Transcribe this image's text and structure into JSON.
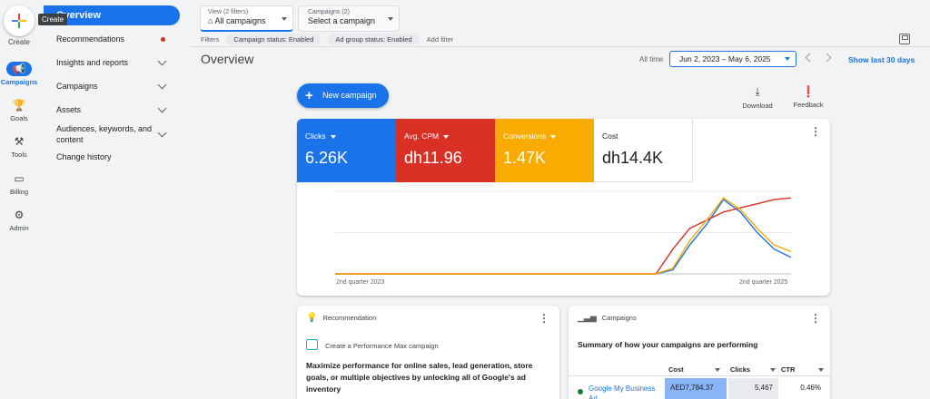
{
  "rail": {
    "create_label": "Create",
    "tooltip": "Create",
    "items": [
      {
        "label": "Campaigns",
        "icon": "megaphone-icon",
        "active": true
      },
      {
        "label": "Goals",
        "icon": "trophy-icon"
      },
      {
        "label": "Tools",
        "icon": "tools-icon"
      },
      {
        "label": "Billing",
        "icon": "credit-card-icon"
      },
      {
        "label": "Admin",
        "icon": "gear-icon"
      }
    ]
  },
  "nav": {
    "active": "Overview",
    "items": [
      "Recommendations",
      "Insights and reports",
      "Campaigns",
      "Assets",
      "Audiences, keywords, and content",
      "Change history"
    ]
  },
  "view": {
    "label": "View (2 filters)",
    "value": "All campaigns"
  },
  "campaign_select": {
    "label": "Campaigns (2)",
    "value": "Select a campaign"
  },
  "filters": {
    "label": "Filters",
    "chips": [
      "Campaign status: Enabled",
      "Ad group status: Enabled"
    ],
    "add": "Add filter"
  },
  "page_title": "Overview",
  "date": {
    "all_time": "All time",
    "range": "Jun 2, 2023 – May 6, 2025",
    "show": "Show last 30 days"
  },
  "actions": {
    "new_campaign": "New campaign",
    "download": "Download",
    "feedback": "Feedback"
  },
  "metrics": [
    {
      "label": "Clicks",
      "value": "6.26K",
      "color": "#1a73e8"
    },
    {
      "label": "Avg. CPM",
      "value": "dh11.96",
      "color": "#d93025"
    },
    {
      "label": "Conversions",
      "value": "1.47K",
      "color": "#f9ab00"
    },
    {
      "label": "Cost",
      "value": "dh14.4K",
      "color": "#ffffff"
    }
  ],
  "chart_data": {
    "type": "line",
    "x": [
      "2nd quarter 2023",
      "",
      "",
      "",
      "",
      "",
      "",
      "",
      "",
      "",
      "",
      "",
      "",
      "",
      "",
      "",
      "",
      "",
      "",
      "",
      "",
      "",
      "",
      "",
      "",
      "",
      "",
      "2nd quarter 2025"
    ],
    "x_tick_labels": [
      "2nd quarter 2023",
      "2nd quarter 2025"
    ],
    "series": [
      {
        "color": "#1a73e8",
        "values": [
          0,
          0,
          0,
          0,
          0,
          0,
          0,
          0,
          0,
          0,
          0,
          0,
          0,
          0,
          0,
          0,
          0,
          0,
          0,
          0,
          0.05,
          0.35,
          0.6,
          0.9,
          0.75,
          0.5,
          0.3,
          0.2
        ]
      },
      {
        "color": "#d93025",
        "values": [
          0,
          0,
          0,
          0,
          0,
          0,
          0,
          0,
          0,
          0,
          0,
          0,
          0,
          0,
          0,
          0,
          0,
          0,
          0,
          0,
          0.3,
          0.55,
          0.65,
          0.75,
          0.8,
          0.85,
          0.9,
          0.92
        ]
      },
      {
        "color": "#f9ab00",
        "values": [
          0,
          0,
          0,
          0,
          0,
          0,
          0,
          0,
          0,
          0,
          0,
          0,
          0,
          0,
          0,
          0,
          0,
          0,
          0,
          0,
          0.07,
          0.4,
          0.65,
          0.92,
          0.78,
          0.55,
          0.35,
          0.27
        ]
      }
    ]
  },
  "recommendation": {
    "title": "Recommendation",
    "link": "Create a Performance Max campaign",
    "body": "Maximize performance for online sales, lead generation, store goals, or multiple objectives by unlocking all of Google's ad inventory"
  },
  "campaigns_card": {
    "title": "Campaigns",
    "summary": "Summary of how your campaigns are performing",
    "columns": [
      "Cost",
      "Clicks",
      "CTR"
    ],
    "rows": [
      {
        "name": "Google My Business Ad",
        "cost": "AED7,784.37",
        "clicks": "5,467",
        "ctr": "0.46%"
      }
    ]
  }
}
